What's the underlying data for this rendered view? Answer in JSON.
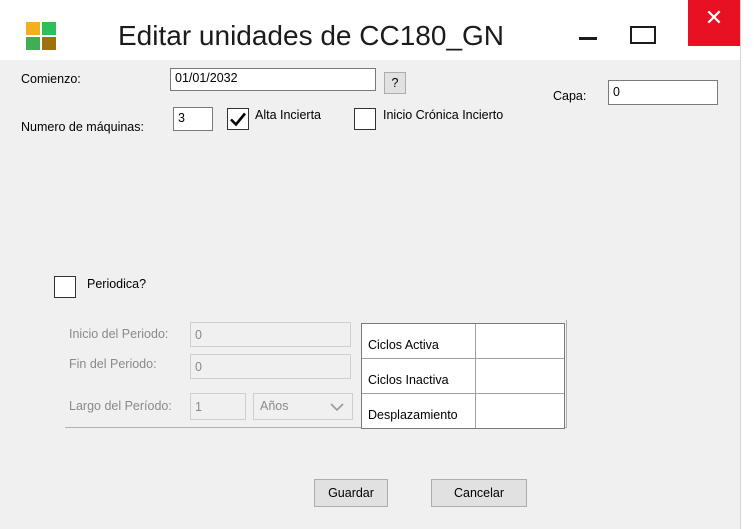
{
  "window": {
    "title": "Editar unidades de CC180_GN",
    "icon": "app-grid-icon",
    "icon_colors": [
      "#f2b01e",
      "#2dbf5e",
      "#3fae55",
      "#a0700a"
    ],
    "minimize_icon": "minimize-icon",
    "maximize_icon": "maximize-icon",
    "close_icon": "close-icon",
    "close_glyph": "✕",
    "close_color": "#e81123"
  },
  "form": {
    "comienzo_label": "Comienzo:",
    "comienzo_value": "01/01/2032",
    "help_label": "?",
    "capa_label": "Capa:",
    "capa_value": "0",
    "maquinas_label": "Numero de máquinas:",
    "maquinas_value": "3",
    "alta_incierta_label": "Alta Incierta",
    "alta_incierta_checked": true,
    "inicio_cronica_label": "Inicio Crónica Incierto",
    "inicio_cronica_checked": false,
    "periodica_label": "Periodica?",
    "periodica_checked": false
  },
  "period": {
    "inicio_label": "Inicio del Periodo:",
    "inicio_value": "0",
    "fin_label": "Fin del Periodo:",
    "fin_value": "0",
    "largo_label": "Largo del Período:",
    "largo_value": "1",
    "unit_selected": "Años",
    "enabled": false
  },
  "cycles": {
    "rows": [
      {
        "label": "Ciclos Activa",
        "value": ""
      },
      {
        "label": "Ciclos Inactiva",
        "value": ""
      },
      {
        "label": "Desplazamiento",
        "value": ""
      }
    ]
  },
  "buttons": {
    "save": "Guardar",
    "cancel": "Cancelar"
  }
}
